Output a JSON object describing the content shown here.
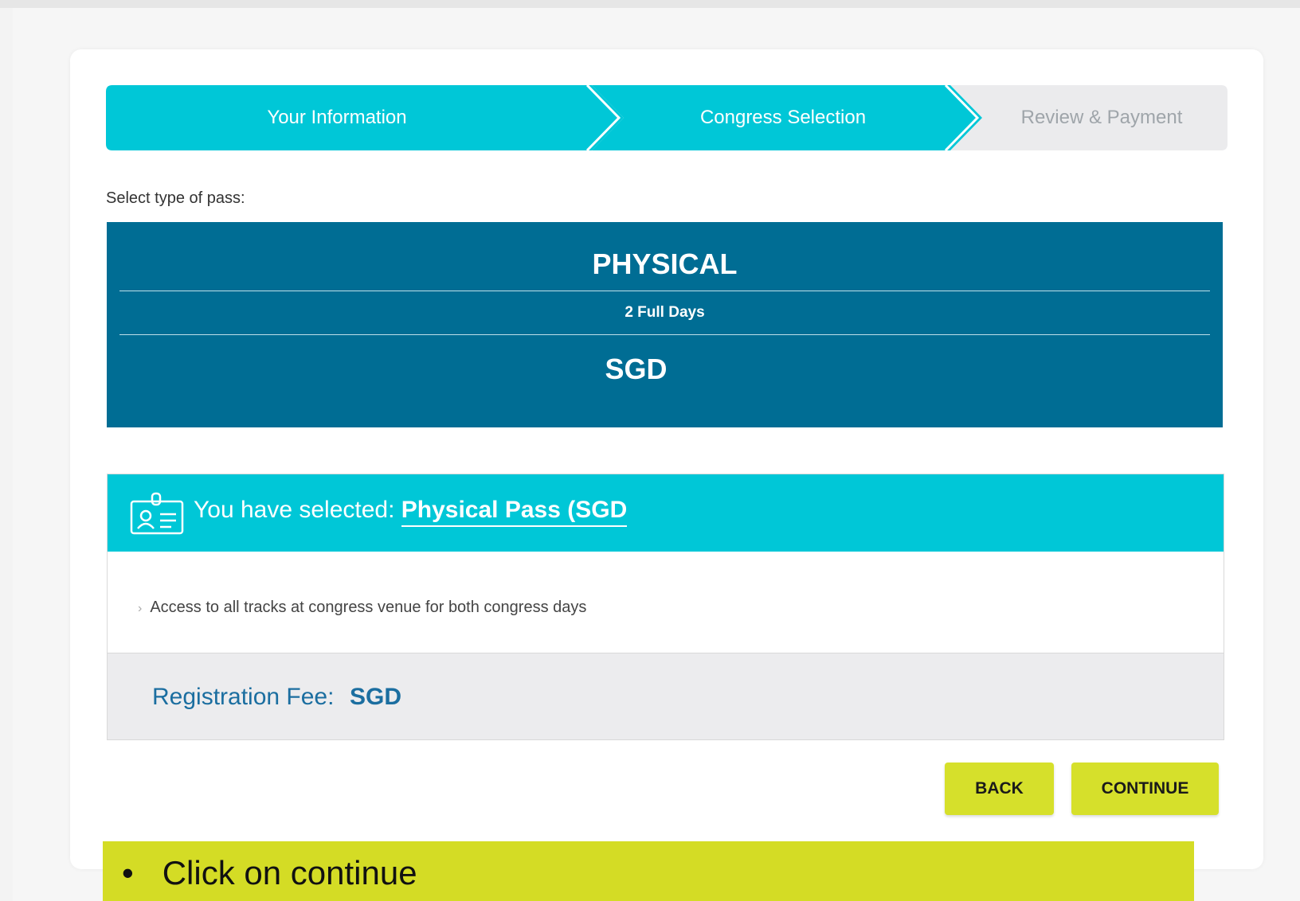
{
  "stepper": {
    "steps": [
      {
        "label": "Your Information",
        "state": "complete"
      },
      {
        "label": "Congress Selection",
        "state": "active"
      },
      {
        "label": "Review & Payment",
        "state": "upcoming"
      }
    ]
  },
  "select_label": "Select type of pass:",
  "pass": {
    "title": "PHYSICAL",
    "duration": "2 Full Days",
    "currency": "SGD"
  },
  "selection": {
    "prefix": "You have selected:",
    "pass_name": "Physical Pass (SGD",
    "features": [
      "Access to all tracks at congress venue for both congress days"
    ],
    "fee_label": "Registration Fee:",
    "fee_value": "SGD"
  },
  "buttons": {
    "back": "BACK",
    "continue": "CONTINUE"
  },
  "callout": {
    "bullet": "•",
    "text": "Click on continue"
  },
  "colors": {
    "accent": "#00c7d7",
    "pass_card": "#006d94",
    "button": "#d6e02b",
    "callout": "#d4dc25"
  }
}
